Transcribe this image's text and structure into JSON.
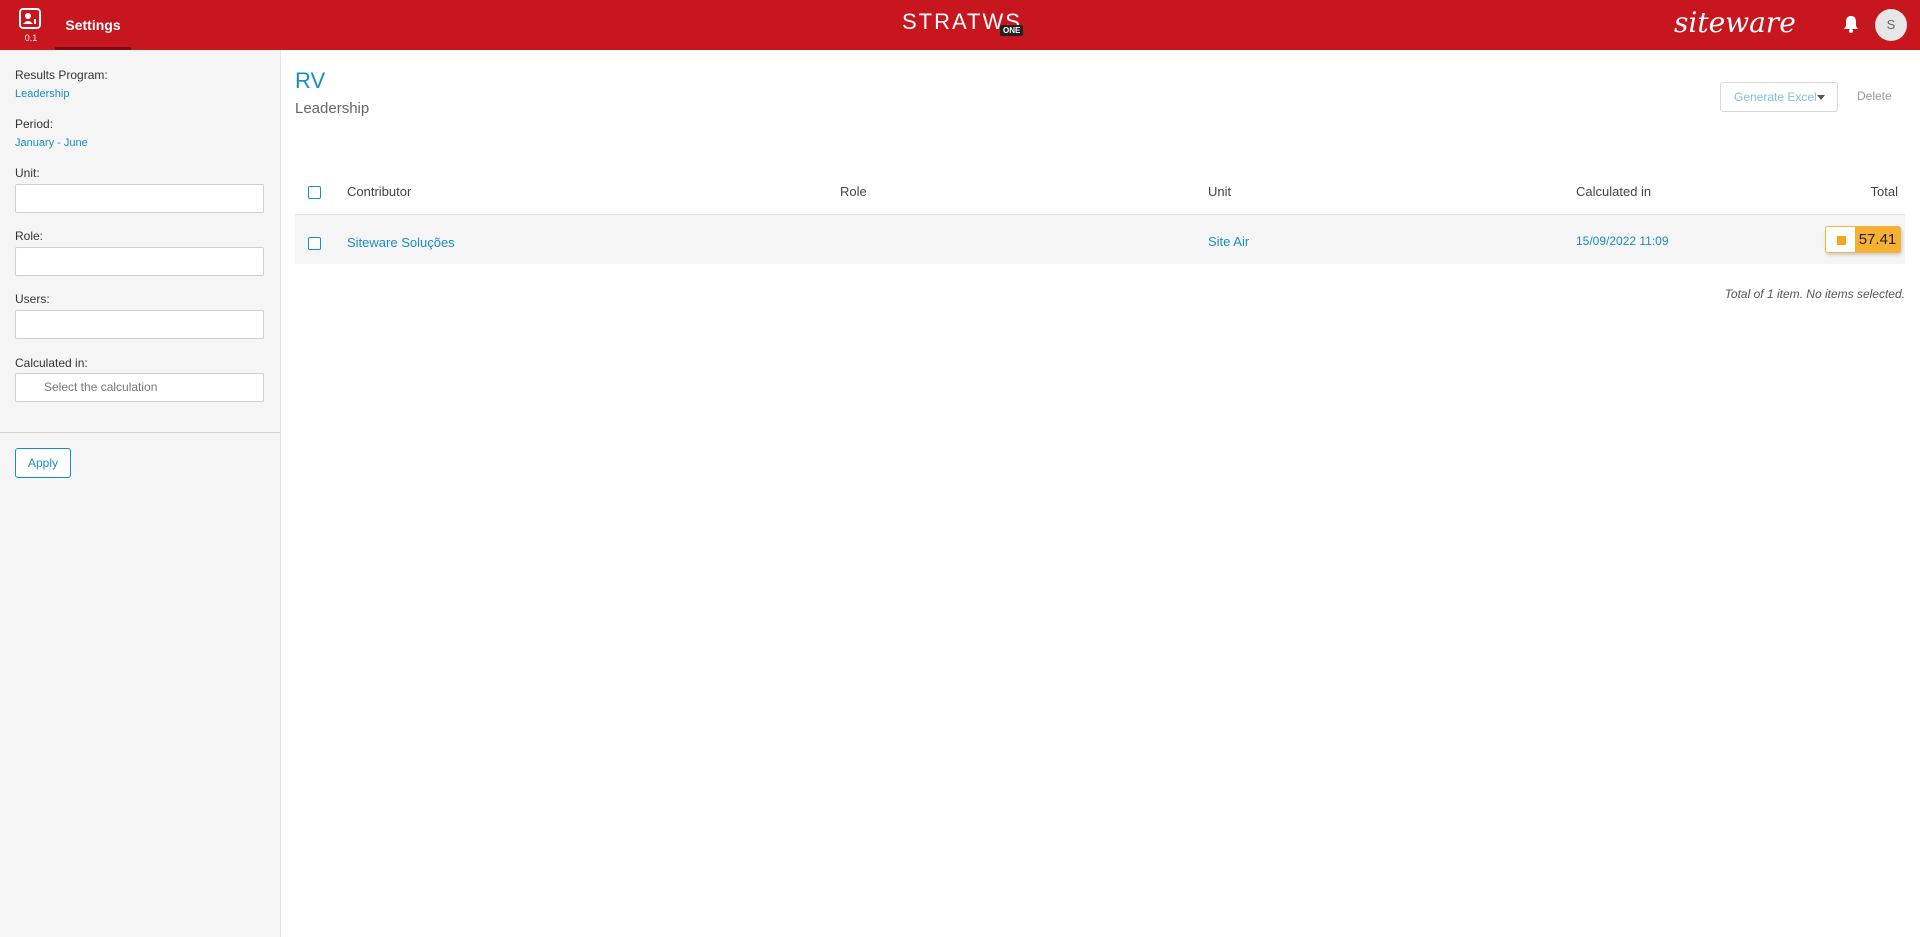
{
  "header": {
    "app_version": "0.1",
    "settings_tab": "Settings",
    "logo_text": "STRATWS",
    "logo_badge": "ONE",
    "brand": "siteware",
    "avatar_initial": "S"
  },
  "sidebar": {
    "results_program_label": "Results Program:",
    "results_program_value": "Leadership",
    "period_label": "Period:",
    "period_value": "January - June",
    "unit_label": "Unit:",
    "role_label": "Role:",
    "users_label": "Users:",
    "calculated_label": "Calculated in:",
    "calculated_placeholder": "Select the calculation",
    "apply_label": "Apply"
  },
  "main": {
    "title": "RV",
    "subtitle": "Leadership",
    "generate_excel_label": "Generate Excel",
    "delete_label": "Delete",
    "columns": [
      "Contributor",
      "Role",
      "Unit",
      "Calculated in",
      "Total"
    ],
    "rows": [
      {
        "contributor": "Siteware Soluções",
        "role": "",
        "unit": "Site Air",
        "calculated_in": "15/09/2022 11:09",
        "total": "57.41"
      }
    ],
    "footer": "Total of 1 item. No items selected."
  },
  "colors": {
    "topbar": "#c8161e",
    "accent": "#1a8cc4",
    "total_badge": "#f6b133"
  }
}
